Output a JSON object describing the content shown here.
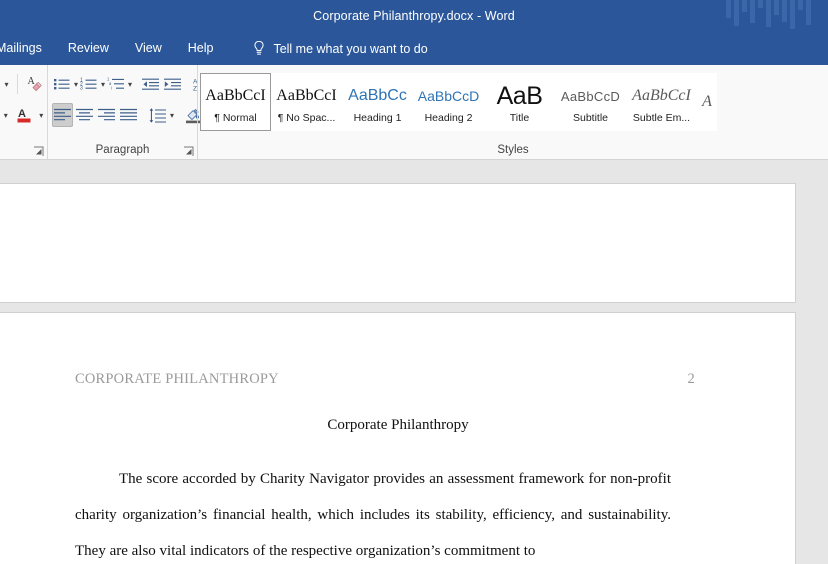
{
  "window": {
    "title": "Corporate Philanthropy.docx  -  Word"
  },
  "colors": {
    "titlebar_blue": "#2b579a",
    "ribbon_bg": "#f9f9f9",
    "doc_backdrop": "#e6e6e6",
    "heading_style_blue": "#2e74b5",
    "header_gray": "#9a9a9a"
  },
  "tabs": [
    {
      "label": "Mailings"
    },
    {
      "label": "Review"
    },
    {
      "label": "View"
    },
    {
      "label": "Help"
    }
  ],
  "tellme": {
    "icon": "lightbulb-icon",
    "label": "Tell me what you want to do"
  },
  "ribbon": {
    "groups": [
      {
        "name": "font",
        "label": "",
        "row1": [
          {
            "icon": "font-size-caret-icon"
          },
          {
            "icon": "clear-formatting-icon"
          }
        ],
        "row2": [
          {
            "icon": "text-effects-caret-icon"
          },
          {
            "icon": "font-color-icon"
          },
          {
            "icon": "font-color-caret-icon"
          }
        ]
      },
      {
        "name": "paragraph",
        "label": "Paragraph",
        "row1": [
          {
            "icon": "bullets-icon"
          },
          {
            "icon": "bullets-caret-icon"
          },
          {
            "icon": "numbering-icon"
          },
          {
            "icon": "numbering-caret-icon"
          },
          {
            "icon": "multilevel-list-icon"
          },
          {
            "icon": "multilevel-list-caret-icon"
          },
          {
            "icon": "decrease-indent-icon"
          },
          {
            "icon": "increase-indent-icon"
          },
          {
            "icon": "sort-icon"
          },
          {
            "icon": "show-formatting-marks-icon"
          }
        ],
        "row2": [
          {
            "icon": "align-left-icon",
            "selected": true
          },
          {
            "icon": "align-center-icon"
          },
          {
            "icon": "align-right-icon"
          },
          {
            "icon": "justify-icon"
          },
          {
            "icon": "line-spacing-icon"
          },
          {
            "icon": "line-spacing-caret-icon"
          },
          {
            "icon": "shading-icon"
          },
          {
            "icon": "shading-caret-icon"
          },
          {
            "icon": "borders-icon"
          },
          {
            "icon": "borders-caret-icon"
          }
        ]
      },
      {
        "name": "styles",
        "label": "Styles"
      }
    ]
  },
  "styles_gallery": [
    {
      "preview": "AaBbCcI",
      "name": "¶ Normal",
      "kind": "normal",
      "active": true
    },
    {
      "preview": "AaBbCcI",
      "name": "¶ No Spac...",
      "kind": "normal",
      "active": false
    },
    {
      "preview": "AaBbCc",
      "name": "Heading 1",
      "kind": "heading",
      "active": false
    },
    {
      "preview": "AaBbCcD",
      "name": "Heading 2",
      "kind": "heading",
      "active": false
    },
    {
      "preview": "AaB",
      "name": "Title",
      "kind": "title",
      "active": false
    },
    {
      "preview": "AaBbCcD",
      "name": "Subtitle",
      "kind": "subtitle",
      "active": false
    },
    {
      "preview": "AaBbCcI",
      "name": "Subtle Em...",
      "kind": "subtleem",
      "active": false
    },
    {
      "preview": "A",
      "name": "",
      "kind": "subtleem",
      "active": false
    }
  ],
  "document": {
    "running_header": "CORPORATE PHILANTHROPY",
    "page_number": "2",
    "title": "Corporate Philanthropy",
    "body": "The score accorded by Charity Navigator provides an assessment framework for non-profit charity organization’s financial health, which includes its stability, efficiency, and sustainability. They are also vital indicators of the respective organization’s commitment to"
  }
}
